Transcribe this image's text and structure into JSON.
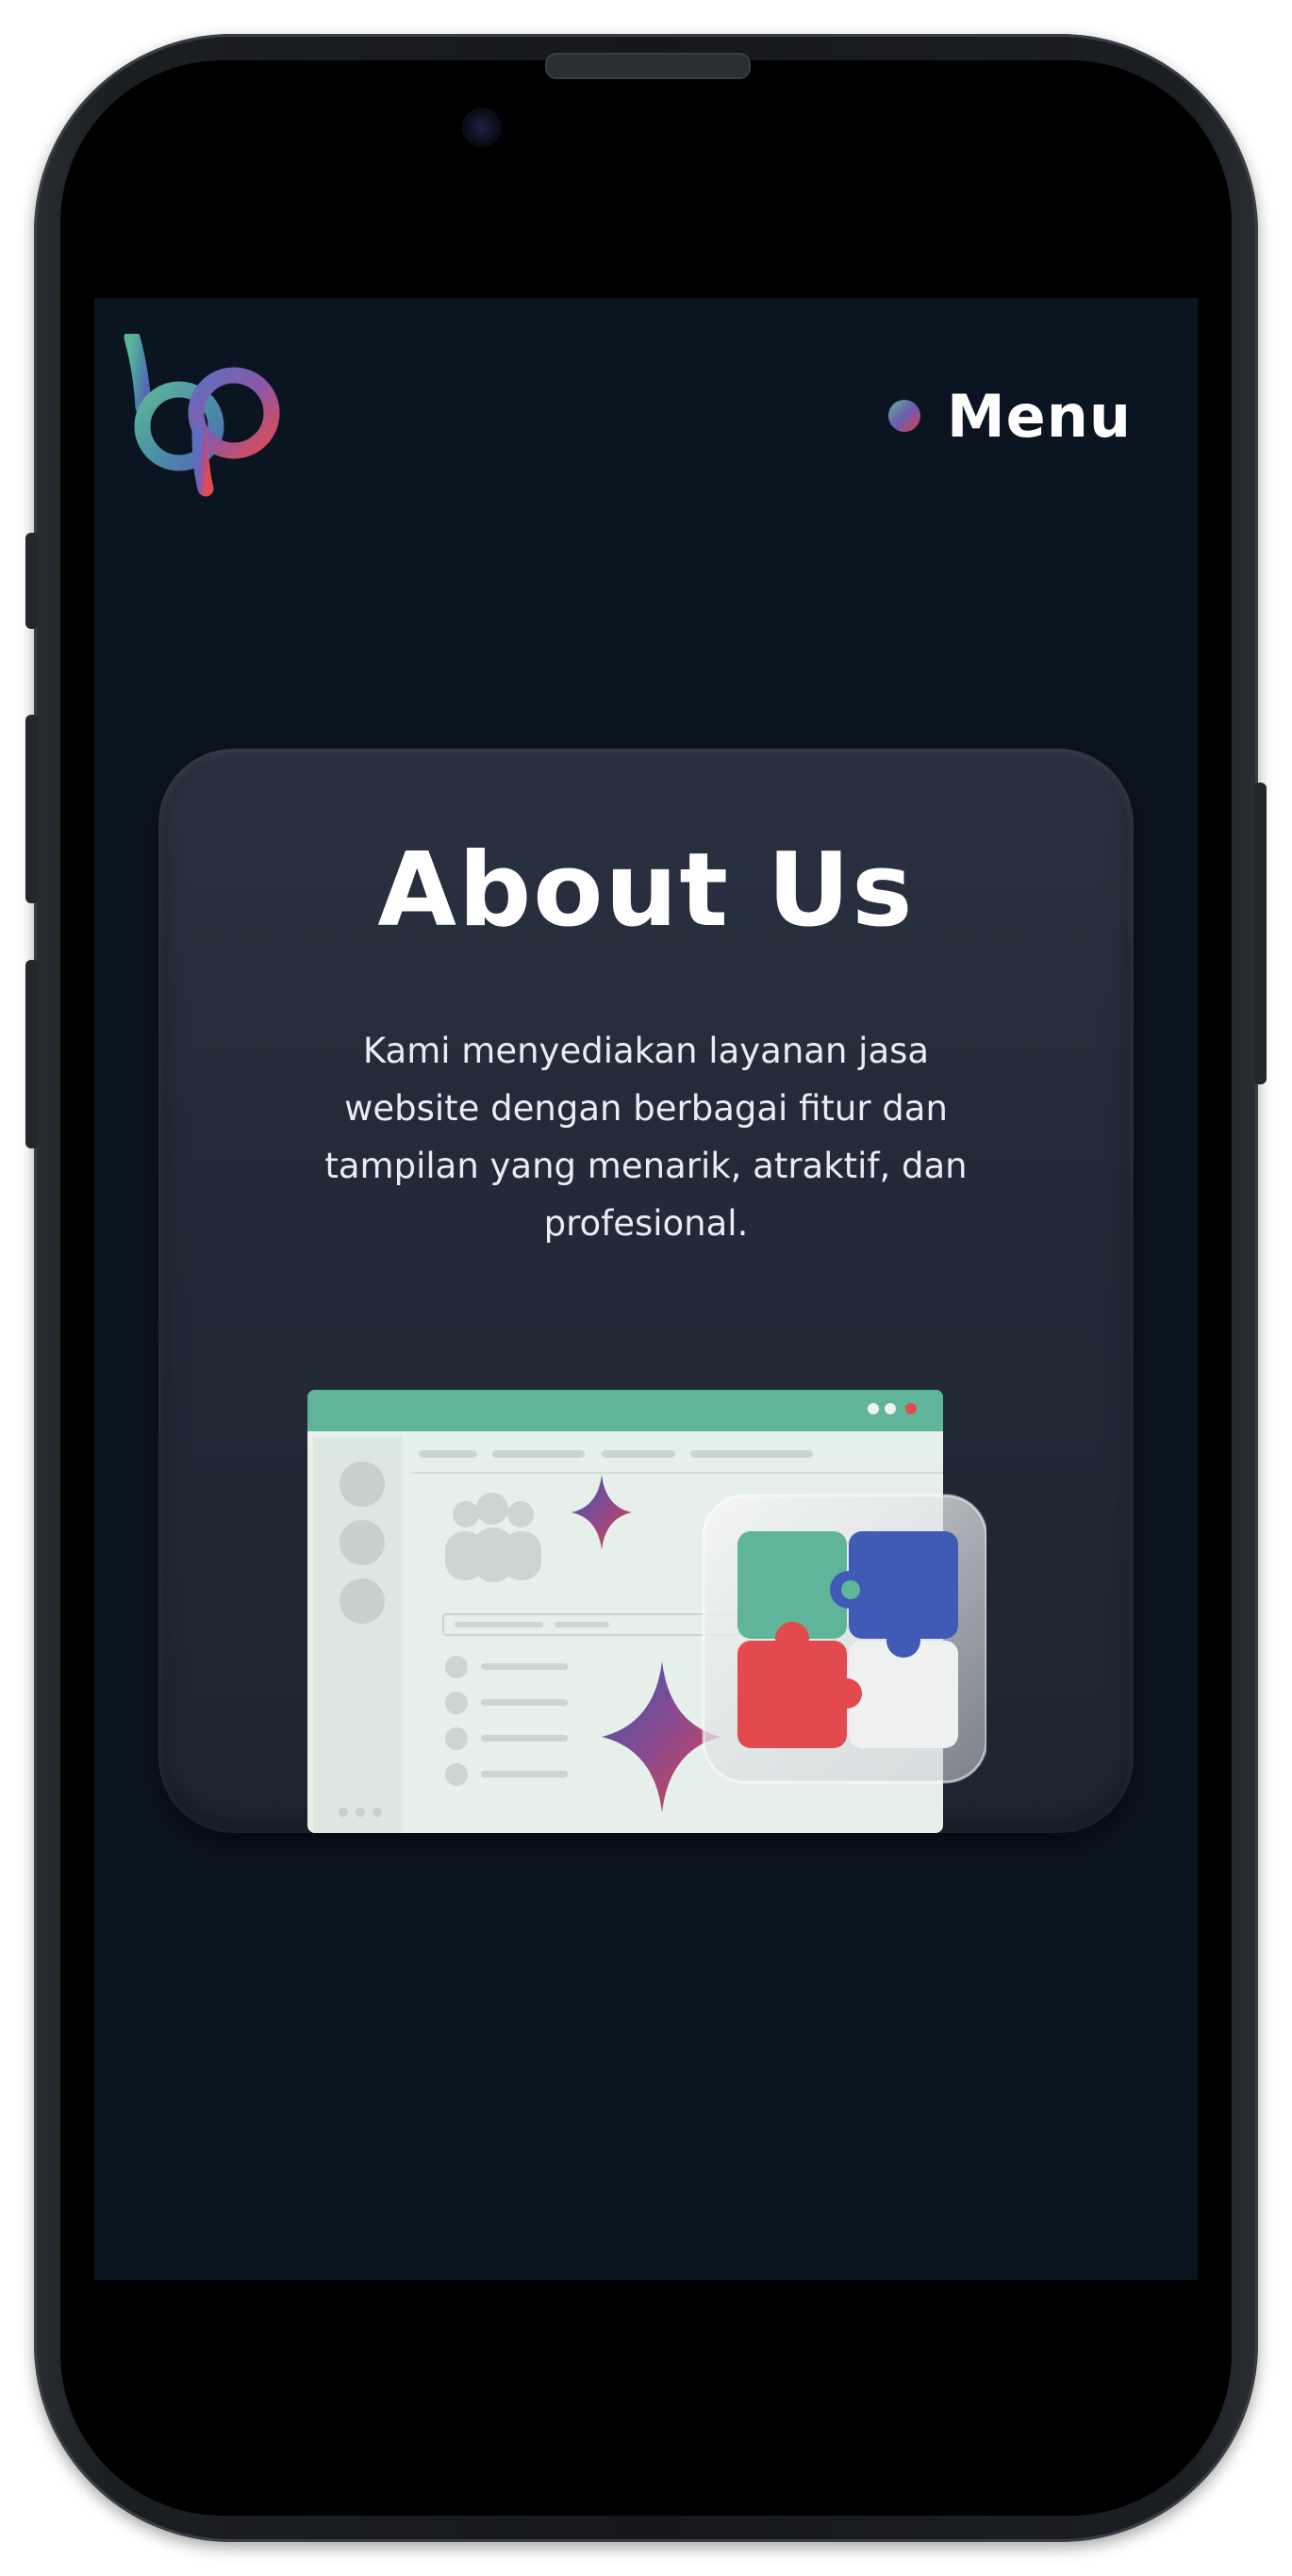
{
  "header": {
    "logo_text": "bp",
    "menu_label": "Menu"
  },
  "about": {
    "title": "About Us",
    "description": "Kami menyediakan layanan jasa website dengan berbagai fitur dan tampilan yang menarik, atraktif, dan profesional."
  },
  "icons": {
    "logo": "bp-logo-icon",
    "menu_bullet": "gradient-dot-icon",
    "illustration": "website-puzzle-illustration"
  },
  "colors": {
    "page_background": "#0b1421",
    "card_background": "#232938",
    "accent_green": "#5fb49a",
    "accent_blue": "#3f5bb5",
    "accent_red": "#e24a4e",
    "text": "#ffffff"
  }
}
